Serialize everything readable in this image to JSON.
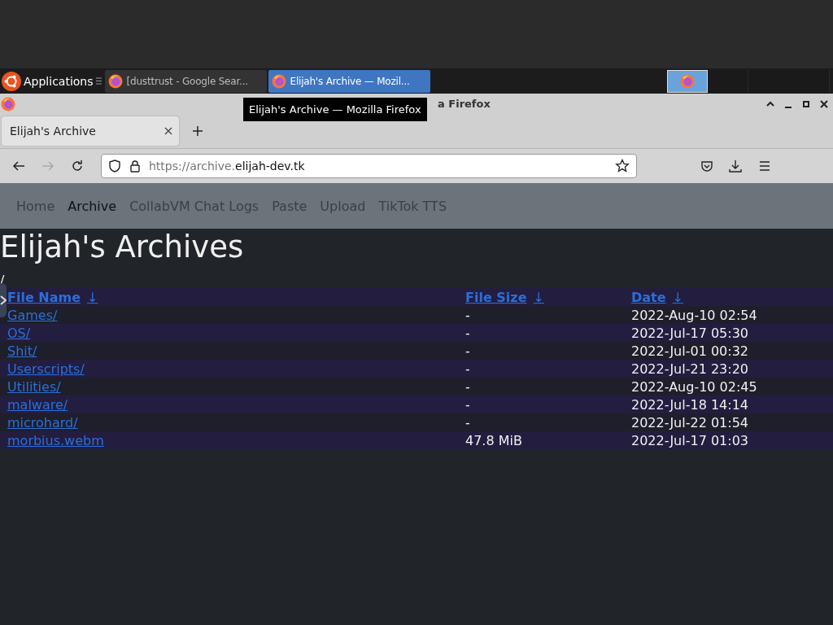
{
  "taskbar": {
    "menu_label": "Applications",
    "tasks": [
      {
        "label": "[dusttrust - Google Sear...",
        "selected": false
      },
      {
        "label": "Elijah's Archive — Mozil...",
        "selected": true
      }
    ],
    "workspaces": [
      {
        "selected": true
      },
      {
        "selected": false
      },
      {
        "selected": false
      }
    ]
  },
  "tooltip": "Elijah's Archive — Mozilla Firefox",
  "window": {
    "title": "a Firefox"
  },
  "tabs": [
    {
      "label": "Elijah's Archive",
      "selected": true
    }
  ],
  "toolbar": {
    "url_prefix": "https://archive.",
    "url_host": "elijah-dev.tk",
    "forward_disabled": true
  },
  "site_nav": [
    {
      "label": "Home",
      "selected": false
    },
    {
      "label": "Archive",
      "selected": true
    },
    {
      "label": "CollabVM Chat Logs",
      "selected": false
    },
    {
      "label": "Paste",
      "selected": false
    },
    {
      "label": "Upload",
      "selected": false
    },
    {
      "label": "TikTok TTS",
      "selected": false
    }
  ],
  "heading": "Elijah's Archives",
  "path": "/",
  "table": {
    "columns": [
      {
        "label": "File Name",
        "sort_arrow": "↓"
      },
      {
        "label": "File Size",
        "sort_arrow": "↓"
      },
      {
        "label": "Date",
        "sort_arrow": "↓"
      }
    ],
    "rows": [
      {
        "name": "Games/",
        "size": "-",
        "date": "2022-Aug-10 02:54"
      },
      {
        "name": "OS/",
        "size": "-",
        "date": "2022-Jul-17 05:30"
      },
      {
        "name": "Shit/",
        "size": "-",
        "date": "2022-Jul-01 00:32"
      },
      {
        "name": "Userscripts/",
        "size": "-",
        "date": "2022-Jul-21 23:20"
      },
      {
        "name": "Utilities/",
        "size": "-",
        "date": "2022-Aug-10 02:45"
      },
      {
        "name": "malware/",
        "size": "-",
        "date": "2022-Jul-18 14:14"
      },
      {
        "name": "microhard/",
        "size": "-",
        "date": "2022-Jul-22 01:54"
      },
      {
        "name": "morbius.webm",
        "size": "47.8 MiB",
        "date": "2022-Jul-17 01:03"
      }
    ]
  }
}
